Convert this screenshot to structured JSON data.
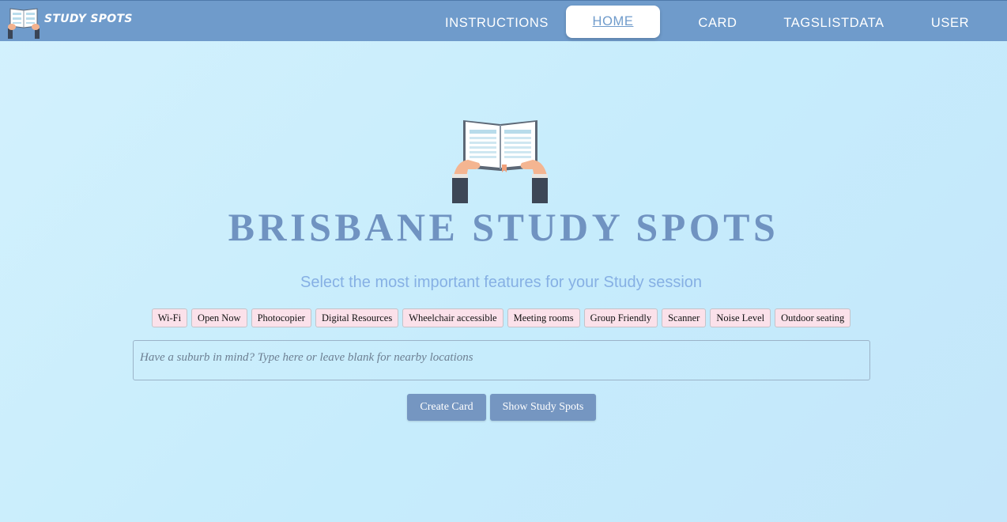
{
  "brand": {
    "name": "STUDY SPOTS",
    "logo_icon": "open-book-hands-icon"
  },
  "nav": {
    "items": [
      {
        "label": "INSTRUCTIONS"
      },
      {
        "label": "HOME",
        "active": true
      },
      {
        "label": "CARD"
      },
      {
        "label": "TAGSLISTDATA"
      },
      {
        "label": "USER"
      }
    ]
  },
  "hero": {
    "icon": "open-book-hands-icon",
    "title": "BRISBANE STUDY SPOTS",
    "subtitle": "Select the most important features for your Study session"
  },
  "tags": [
    "Wi-Fi",
    "Open Now",
    "Photocopier",
    "Digital Resources",
    "Wheelchair accessible",
    "Meeting rooms",
    "Group Friendly",
    "Scanner",
    "Noise Level",
    "Outdoor seating"
  ],
  "search": {
    "value": "",
    "placeholder": "Have a suburb in mind? Type here or leave blank for nearby locations"
  },
  "actions": {
    "create_card": "Create Card",
    "show_spots": "Show Study Spots"
  },
  "colors": {
    "navbar": "#6f9bcb",
    "title": "#7093c1",
    "subtitle": "#86b0e4",
    "tag_bg": "#fbe1ea",
    "button": "#7596c1"
  }
}
